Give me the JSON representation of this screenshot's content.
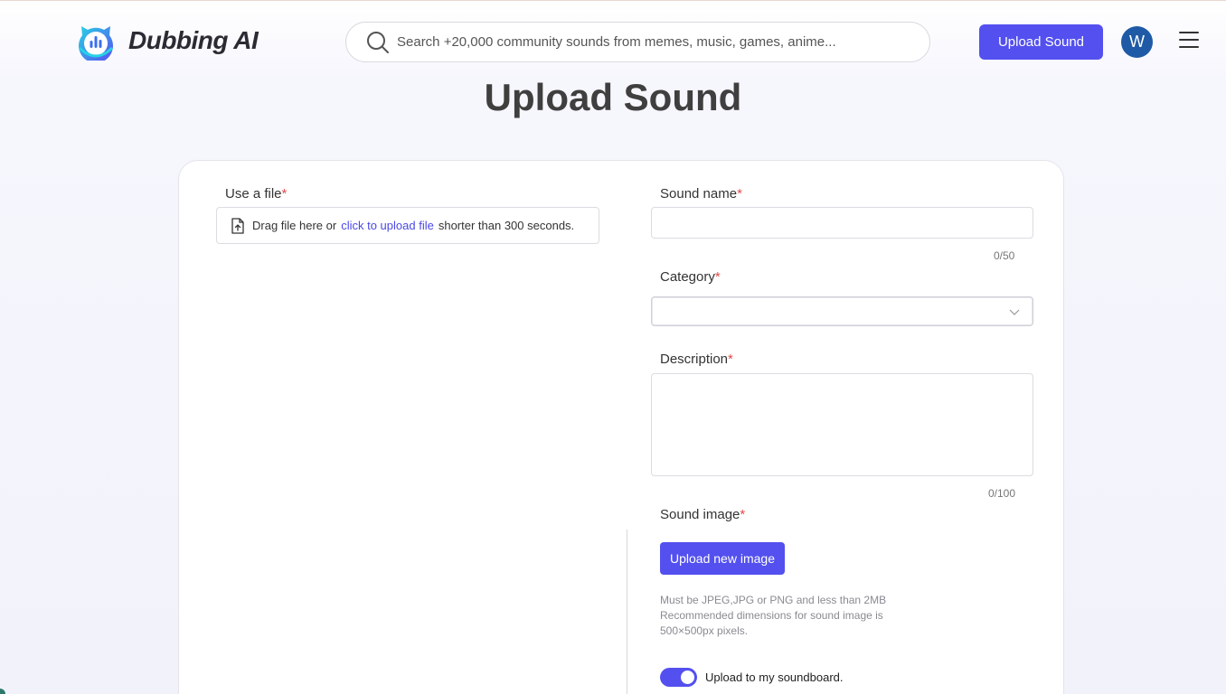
{
  "header": {
    "brand": "Dubbing AI",
    "search_placeholder": "Search +20,000 community sounds from memes, music, games, anime...",
    "upload_button": "Upload Sound",
    "avatar_initial": "W"
  },
  "page": {
    "title": "Upload Sound"
  },
  "form": {
    "file": {
      "label": "Use a file",
      "required_mark": "*",
      "drag_text": "Drag file here or",
      "link_text": "click to upload file",
      "suffix_text": "shorter than 300 seconds."
    },
    "sound_name": {
      "label": "Sound name",
      "required_mark": "*",
      "value": "",
      "counter": "0/50"
    },
    "category": {
      "label": "Category",
      "required_mark": "*",
      "value": ""
    },
    "description": {
      "label": "Description",
      "required_mark": "*",
      "value": "",
      "counter": "0/100"
    },
    "sound_image": {
      "label": "Sound image",
      "required_mark": "*",
      "button": "Upload new image",
      "hint_line1": "Must be JPEG,JPG or PNG and less than 2MB",
      "hint_line2": "Recommended dimensions for sound image is 500×500px pixels."
    },
    "soundboard_toggle": {
      "label": "Upload to my soundboard.",
      "checked": true
    }
  },
  "colors": {
    "accent": "#5350ef",
    "required": "#e24b4b",
    "avatar_bg": "#1f5aa6"
  },
  "icons": {
    "search": "search-icon",
    "upload_file": "file-upload-icon",
    "chevron": "chevron-down-icon",
    "menu": "hamburger-menu-icon"
  }
}
